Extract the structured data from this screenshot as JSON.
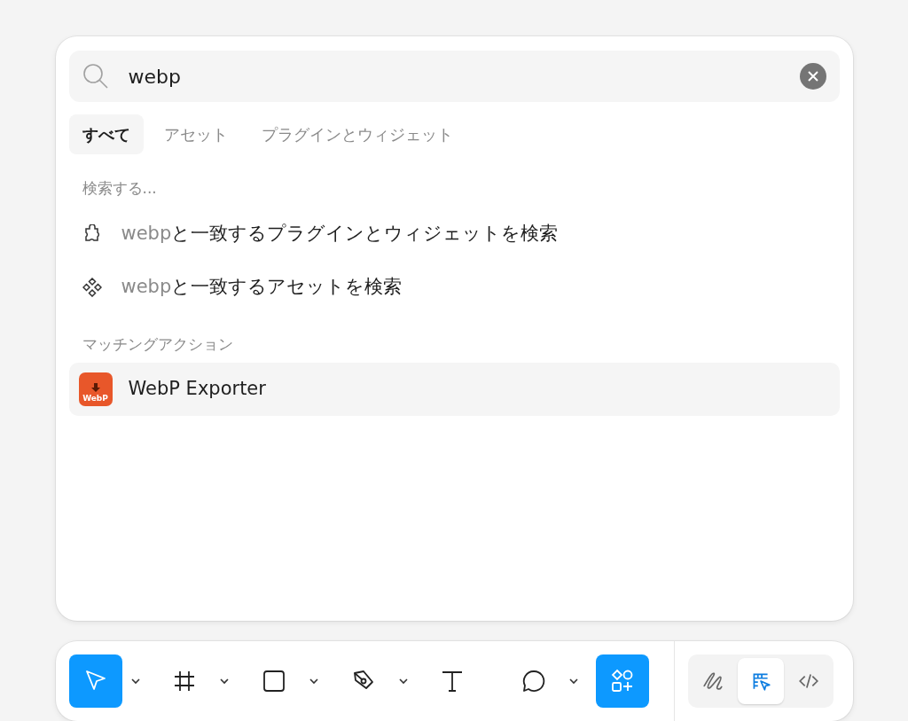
{
  "search": {
    "value": "webp"
  },
  "tabs": [
    {
      "label": "すべて",
      "selected": true
    },
    {
      "label": "アセット",
      "selected": false
    },
    {
      "label": "プラグインとウィジェット",
      "selected": false
    }
  ],
  "search_section": {
    "heading": "検索する...",
    "items": [
      {
        "kind": "plugins",
        "query": "webp",
        "text": "と一致するプラグインとウィジェットを検索"
      },
      {
        "kind": "assets",
        "query": "webp",
        "text": "と一致するアセットを検索"
      }
    ]
  },
  "actions_section": {
    "heading": "マッチングアクション",
    "items": [
      {
        "icon_label": "WebP",
        "label": "WebP Exporter"
      }
    ]
  },
  "toolbar": {
    "tools": [
      {
        "kind": "move",
        "selected": true,
        "caret": true
      },
      {
        "kind": "frame",
        "selected": false,
        "caret": true
      },
      {
        "kind": "rectangle",
        "selected": false,
        "caret": true
      },
      {
        "kind": "pen",
        "selected": false,
        "caret": true
      },
      {
        "kind": "text",
        "selected": false,
        "caret": false
      },
      {
        "kind": "comment",
        "selected": false,
        "caret": true
      },
      {
        "kind": "actions",
        "selected": true,
        "caret": false
      }
    ],
    "modes": [
      {
        "kind": "draw",
        "selected": false
      },
      {
        "kind": "design",
        "selected": true
      },
      {
        "kind": "dev",
        "selected": false
      }
    ]
  }
}
